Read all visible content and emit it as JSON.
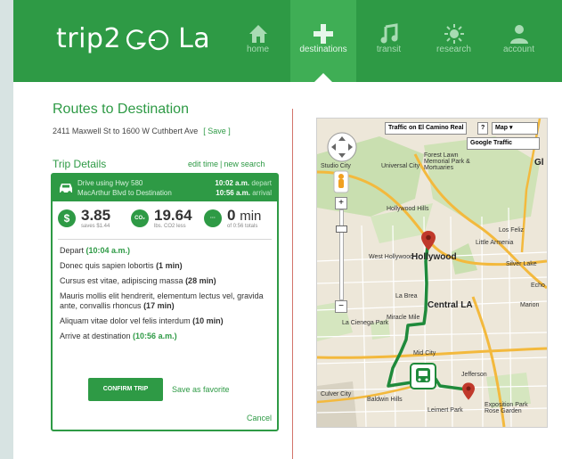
{
  "header": {
    "logo_prefix": "trip2",
    "logo_suffix": "La",
    "nav": [
      {
        "label": "home",
        "icon": "home-icon"
      },
      {
        "label": "destinations",
        "icon": "plus-icon"
      },
      {
        "label": "transit",
        "icon": "music-note-icon"
      },
      {
        "label": "research",
        "icon": "sun-icon"
      },
      {
        "label": "account",
        "icon": "user-icon"
      }
    ],
    "active_nav": "destinations"
  },
  "route": {
    "title": "Routes to Destination",
    "addresses": "2411 Maxwell St to 1600 W Cuthbert Ave",
    "save_label": "[ Save ]"
  },
  "trip": {
    "heading": "Trip Details",
    "edit_time": "edit time",
    "separator": "|",
    "new_search": "new search",
    "mode_line1": "Drive using Hwy 580",
    "mode_line2": "MacArthur Blvd to Destination",
    "depart_time": "10:02 a.m.",
    "depart_label": "depart",
    "arrival_time": "10:56 a.m.",
    "arrival_label": "arrival",
    "metrics": [
      {
        "icon": "$",
        "value": "3.85",
        "unit": "",
        "sub": "saves $1.44"
      },
      {
        "icon": "CO₂",
        "value": "19.64",
        "unit": "",
        "sub": "lbs. CO2 less"
      },
      {
        "icon": "···",
        "value": "0",
        "unit": "min",
        "sub": "of 0:56 totals"
      }
    ],
    "steps": [
      {
        "text": "Depart ",
        "highlight": "(10:04 a.m.)",
        "bold": ""
      },
      {
        "text": "Donec quis sapien lobortis ",
        "highlight": "",
        "bold": "(1 min)"
      },
      {
        "text": "Cursus est vitae, adipiscing massa ",
        "highlight": "",
        "bold": "(28 min)"
      },
      {
        "text": "Mauris mollis elit hendrerit, elementum lectus vel, gravida ante, convallis rhoncus ",
        "highlight": "",
        "bold": "(17 min)"
      },
      {
        "text": "Aliquam vitae dolor vel felis interdum ",
        "highlight": "",
        "bold": "(10 min)"
      },
      {
        "text": "Arrive at destination ",
        "highlight": "(10:56 a.m.)",
        "bold": ""
      }
    ],
    "confirm_label": "CONFIRM TRIP",
    "favorite_label": "Save as favorite",
    "cancel_label": "Cancel"
  },
  "map": {
    "traffic_button": "Traffic on El Camino Real",
    "help_button": "?",
    "type_select": "Map",
    "google_traffic": "Google Traffic",
    "labels": [
      "Studio City",
      "Universal City",
      "Forest Lawn Memorial Park & Mortuaries",
      "Hollywood Hills",
      "West Hollywood",
      "Hollywood",
      "Little Armenia",
      "Los Feliz",
      "Silver Lake",
      "Echo",
      "La Brea",
      "Central LA",
      "Miracle Mile",
      "La Cienega Park",
      "Mid City",
      "Jefferson",
      "Culver City",
      "Baldwin Hills",
      "Leimert Park",
      "Exposition Park Rose Garden",
      "Gl",
      "Marion"
    ]
  },
  "colors": {
    "brand_green": "#2e9a45",
    "active_tab": "#3fae55",
    "marker_red": "#c0392b"
  }
}
